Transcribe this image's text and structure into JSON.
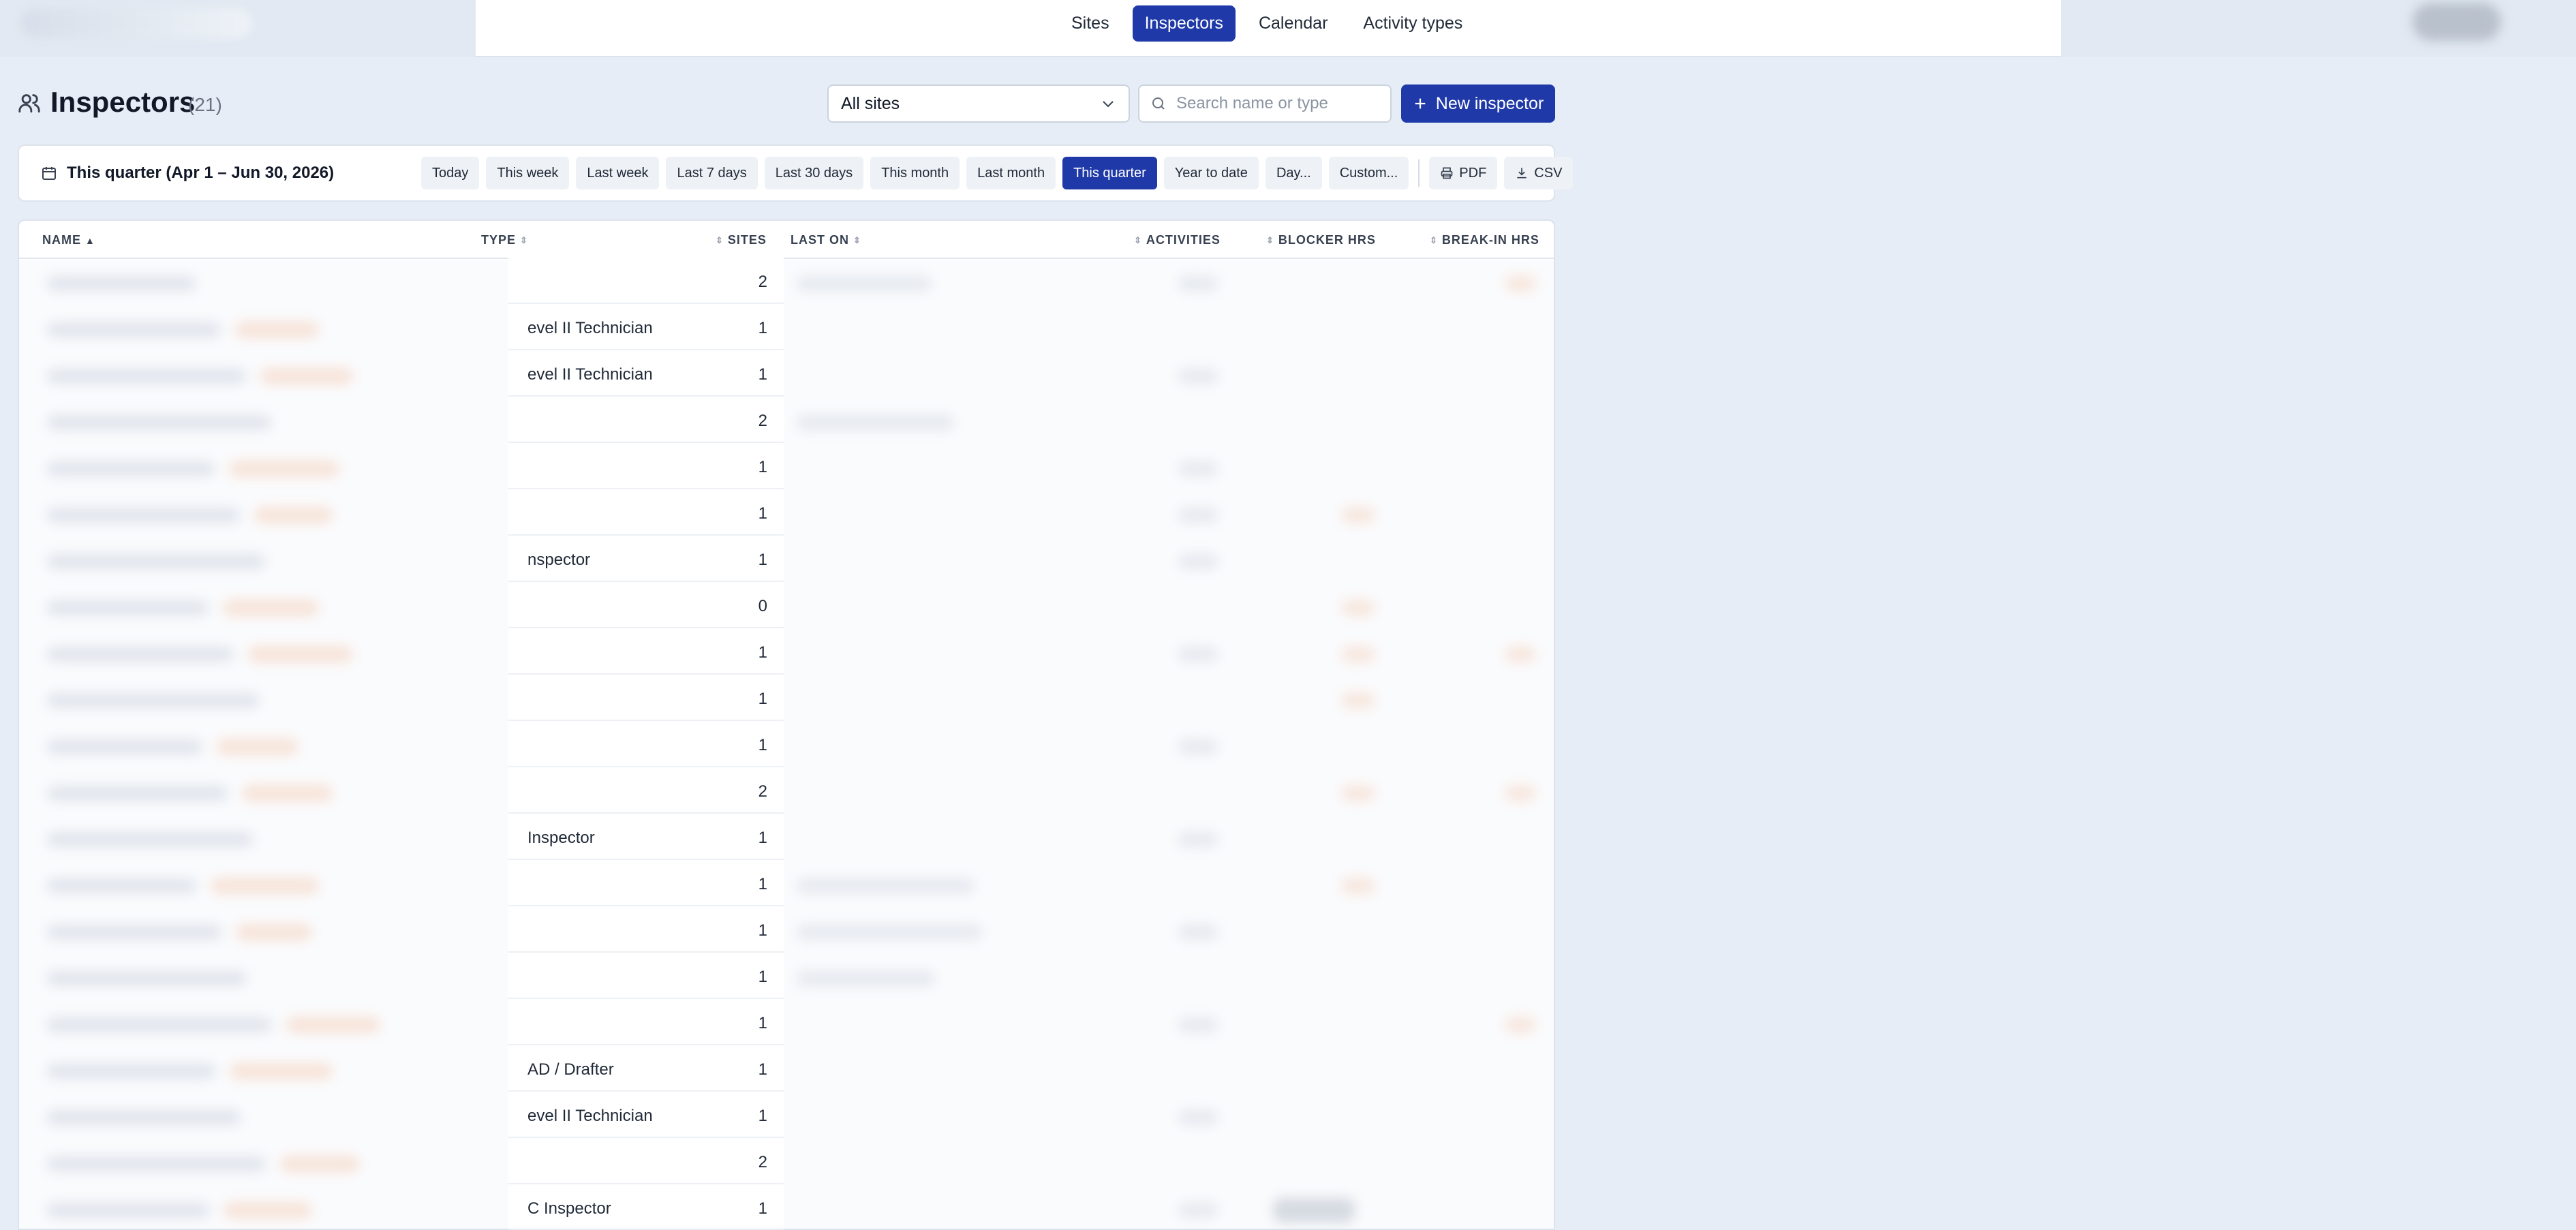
{
  "nav": {
    "items": [
      {
        "label": "Sites",
        "active": false
      },
      {
        "label": "Inspectors",
        "active": true
      },
      {
        "label": "Calendar",
        "active": false
      },
      {
        "label": "Activity types",
        "active": false
      }
    ]
  },
  "page": {
    "title": "Inspectors",
    "count": "(21)",
    "icon": "users-icon"
  },
  "filters": {
    "site_select": "All sites",
    "search_placeholder": "Search name or type",
    "new_button": "New inspector"
  },
  "range": {
    "label": "This quarter (Apr 1 – Jun 30, 2026)",
    "presets": [
      "Today",
      "This week",
      "Last week",
      "Last 7 days",
      "Last 30 days",
      "This month",
      "Last month",
      "This quarter",
      "Year to date",
      "Day...",
      "Custom..."
    ],
    "active_preset": "This quarter",
    "exports": [
      "PDF",
      "CSV"
    ]
  },
  "table": {
    "columns": [
      "NAME",
      "TYPE",
      "SITES",
      "LAST ON",
      "ACTIVITIES",
      "BLOCKER HRS",
      "BREAK-IN HRS"
    ],
    "sorted_by": "NAME",
    "rows": [
      {
        "type": "",
        "sites": "2"
      },
      {
        "type": "evel II Technician",
        "sites": "1"
      },
      {
        "type": "evel II Technician",
        "sites": "1"
      },
      {
        "type": "",
        "sites": "2"
      },
      {
        "type": "",
        "sites": "1"
      },
      {
        "type": "",
        "sites": "1"
      },
      {
        "type": "nspector",
        "sites": "1"
      },
      {
        "type": "",
        "sites": "0"
      },
      {
        "type": "",
        "sites": "1"
      },
      {
        "type": "",
        "sites": "1"
      },
      {
        "type": "",
        "sites": "1"
      },
      {
        "type": "",
        "sites": "2"
      },
      {
        "type": "Inspector",
        "sites": "1"
      },
      {
        "type": "",
        "sites": "1"
      },
      {
        "type": "",
        "sites": "1"
      },
      {
        "type": "",
        "sites": "1"
      },
      {
        "type": "",
        "sites": "1"
      },
      {
        "type": "AD / Drafter",
        "sites": "1"
      },
      {
        "type": "evel II Technician",
        "sites": "1"
      },
      {
        "type": "",
        "sites": "2"
      },
      {
        "type": "C Inspector",
        "sites": "1"
      }
    ]
  },
  "colors": {
    "accent": "#1f3aa8",
    "background": "#e6edf6",
    "blur_highlight": "#f5b38a"
  }
}
